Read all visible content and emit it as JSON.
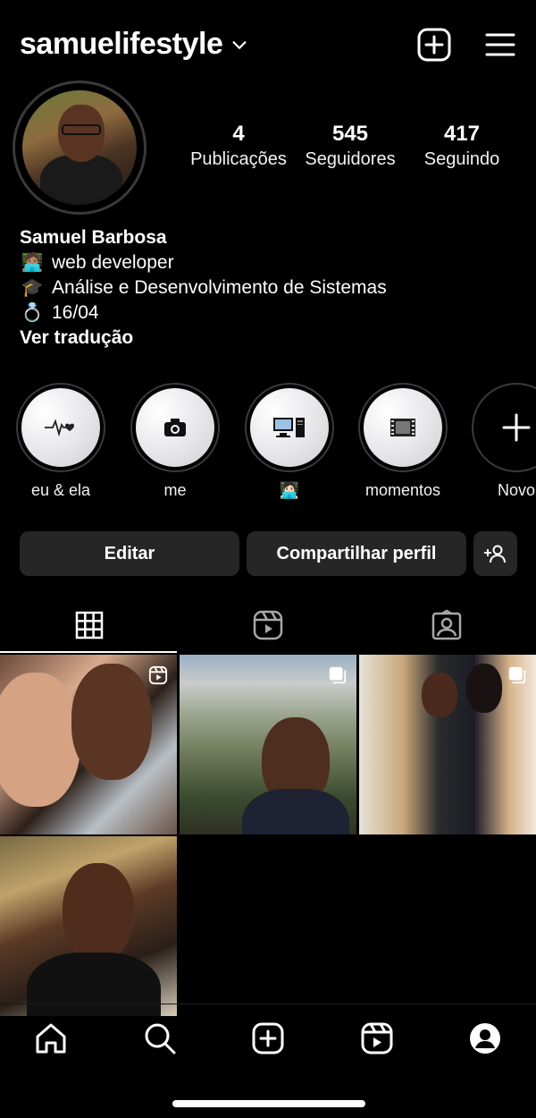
{
  "header": {
    "username": "samuelifestyle",
    "icons": [
      "chevron-down-icon",
      "add-post-icon",
      "menu-icon"
    ]
  },
  "stats": {
    "posts": {
      "value": "4",
      "label": "Publicações"
    },
    "followers": {
      "value": "545",
      "label": "Seguidores"
    },
    "following": {
      "value": "417",
      "label": "Seguindo"
    }
  },
  "bio": {
    "name": "Samuel Barbosa",
    "lines": [
      {
        "emoji": "🧑🏽‍💻",
        "text": "web developer"
      },
      {
        "emoji": "🎓",
        "text": "Análise e Desenvolvimento de Sistemas"
      },
      {
        "emoji": "💍",
        "text": "16/04"
      }
    ],
    "translate": "Ver tradução"
  },
  "highlights": [
    {
      "label": "eu & ela",
      "icon": "heartbeat-icon"
    },
    {
      "label": "me",
      "icon": "camera-icon"
    },
    {
      "label": "🧑🏻‍💻",
      "icon": "computer-icon"
    },
    {
      "label": "momentos",
      "icon": "film-icon"
    },
    {
      "label": "Novo",
      "icon": "plus-icon"
    }
  ],
  "buttons": {
    "edit": "Editar",
    "share": "Compartilhar perfil",
    "discover": "add-person-icon"
  },
  "tabs": [
    "grid-icon",
    "reels-icon",
    "tagged-icon"
  ],
  "posts": [
    {
      "type": "reel",
      "indicator": "reels-icon"
    },
    {
      "type": "carousel",
      "indicator": "carousel-icon"
    },
    {
      "type": "carousel",
      "indicator": "carousel-icon"
    },
    {
      "type": "photo"
    }
  ],
  "bottom_nav": [
    "home-icon",
    "search-icon",
    "create-icon",
    "reels-icon",
    "profile-icon"
  ],
  "colors": {
    "background": "#000000",
    "button": "#262626",
    "text": "#ffffff"
  }
}
